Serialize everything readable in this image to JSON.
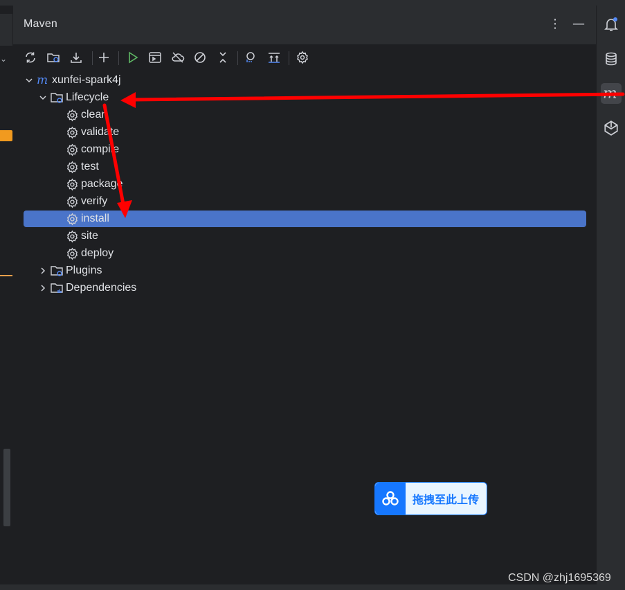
{
  "panel": {
    "title": "Maven",
    "header_buttons": [
      "more-vert-icon",
      "minimize-icon"
    ]
  },
  "toolbar": {
    "buttons": [
      "reload-icon",
      "reload-folder-icon",
      "download-icon",
      "add-icon",
      "run-icon",
      "execute-goal-icon",
      "offline-icon",
      "skip-tests-icon",
      "collapse-icon",
      "show-dependencies-icon",
      "toggle-profile-icon",
      "settings-icon"
    ]
  },
  "tree": {
    "project": "xunfei-spark4j",
    "lifecycle_label": "Lifecycle",
    "lifecycle_items": [
      "clean",
      "validate",
      "compile",
      "test",
      "package",
      "verify",
      "install",
      "site",
      "deploy"
    ],
    "selected_item": "install",
    "plugins_label": "Plugins",
    "dependencies_label": "Dependencies"
  },
  "right_toolbar": {
    "buttons": [
      "notifications-icon",
      "database-icon",
      "maven-icon",
      "ai-assistant-icon"
    ],
    "active": "maven-icon"
  },
  "overlay": {
    "upload_label": "拖拽至此上传",
    "watermark": "CSDN @zhj1695369"
  },
  "colors": {
    "background": "#1e1f22",
    "panel_header": "#2b2d30",
    "selection": "#4a74c9",
    "arrow": "#ff0000",
    "upload_accent": "#1677ff"
  }
}
